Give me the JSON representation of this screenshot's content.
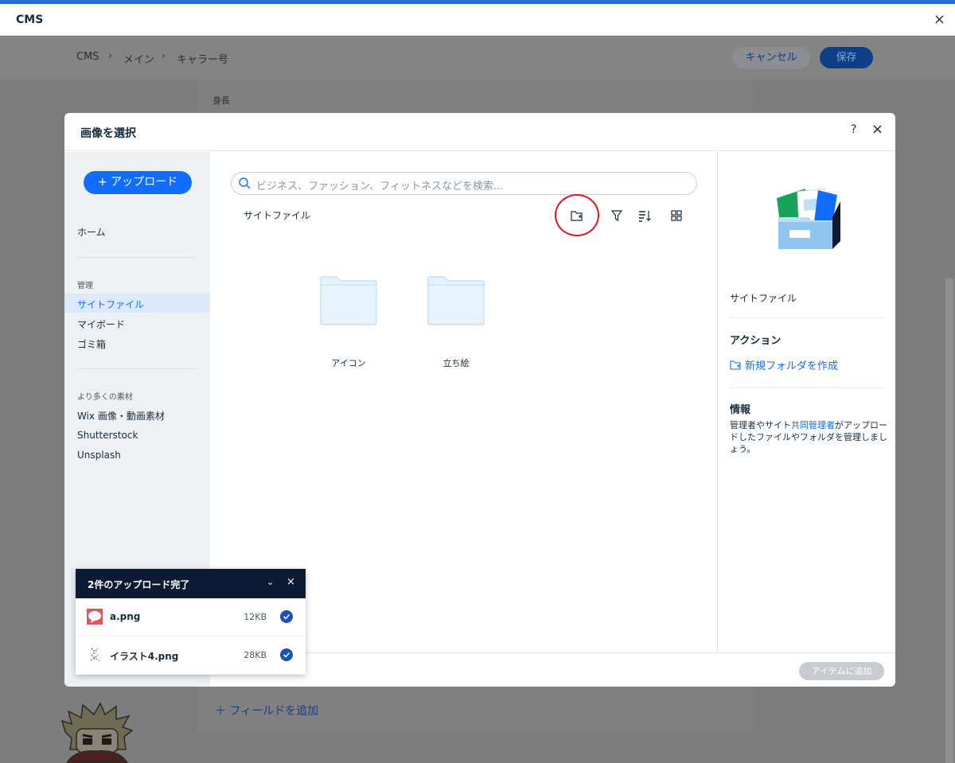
{
  "window": {
    "title": "CMS",
    "close": "×"
  },
  "breadcrumb": {
    "items": [
      "CMS",
      "メイン",
      "キャラー号"
    ],
    "sep": "›"
  },
  "header_actions": {
    "cancel": "キャンセル",
    "save": "保存"
  },
  "background": {
    "field_label": "身長",
    "add_field": "＋ フィールドを追加"
  },
  "modal": {
    "title": "画像を選択",
    "help": "?",
    "close": "×",
    "upload_button": "+ アップロード",
    "sidebar": {
      "home": "ホーム",
      "manage_section": "管理",
      "manage_items": [
        "サイトファイル",
        "マイボード",
        "ゴミ箱"
      ],
      "more_section": "より多くの素材",
      "more_items": [
        "Wix 画像・動画素材",
        "Shutterstock",
        "Unsplash"
      ]
    },
    "search": {
      "placeholder": "ビジネス、ファッション、フィットネスなどを検索..."
    },
    "current_folder": "サイトファイル",
    "folders": [
      "アイコン",
      "立ち絵"
    ],
    "right_panel": {
      "folder_name": "サイトファイル",
      "actions_title": "アクション",
      "new_folder": "新規フォルダを作成",
      "info_title": "情報",
      "info_pre": "管理者やサイト",
      "info_link": "共同管理者",
      "info_post": "がアップロードしたファイルやフォルダを管理しましょう。"
    },
    "footer": {
      "add_button": "アイテムに追加"
    }
  },
  "upload_toast": {
    "title": "2件のアップロード完了",
    "files": [
      {
        "name": "a.png",
        "size": "12KB"
      },
      {
        "name": "イラスト4.png",
        "size": "28KB"
      }
    ]
  },
  "colors": {
    "accent": "#116dff",
    "highlight": "#e8141c",
    "toast_header": "#0c1a33"
  }
}
